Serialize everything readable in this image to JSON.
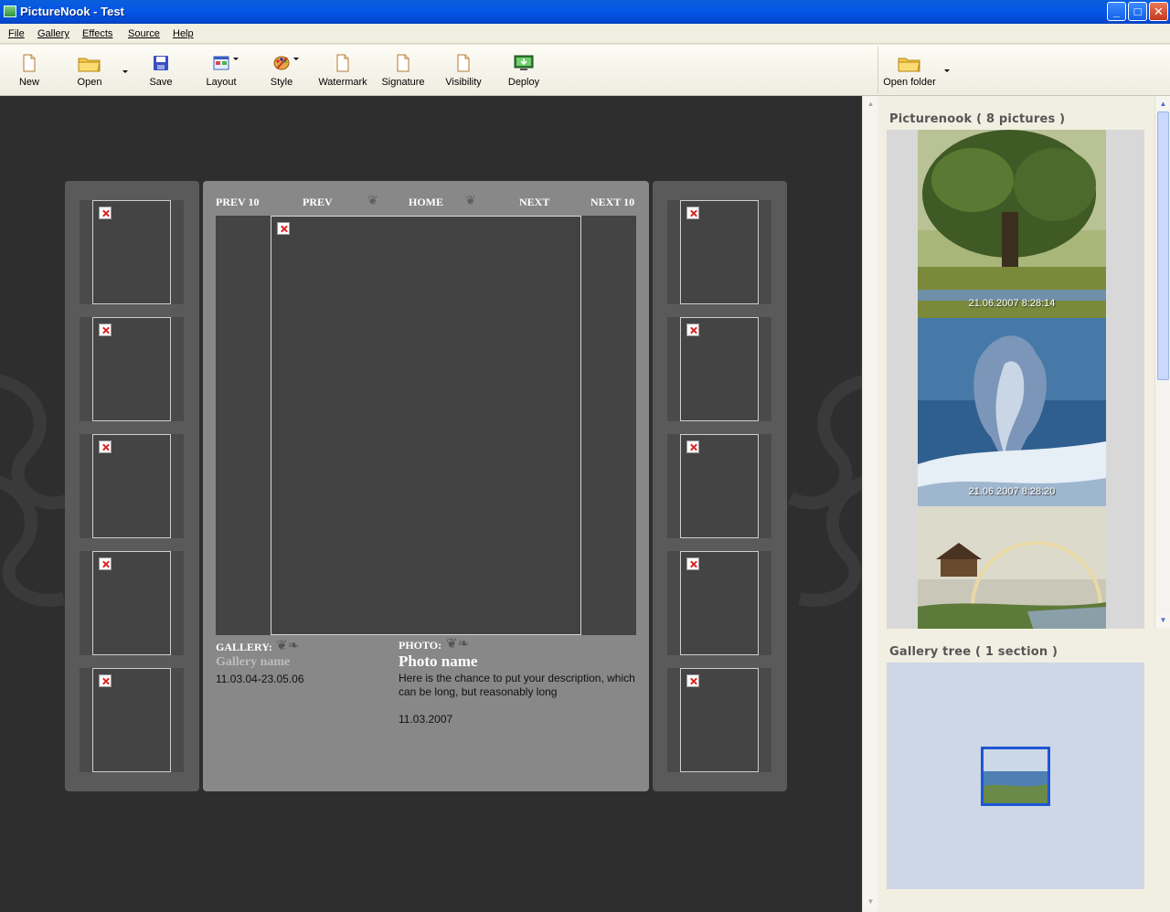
{
  "window": {
    "title": "PictureNook - Test"
  },
  "menu": [
    "File",
    "Gallery",
    "Effects",
    "Source",
    "Help"
  ],
  "toolbar": {
    "new": "New",
    "open": "Open",
    "save": "Save",
    "layout": "Layout",
    "style": "Style",
    "watermark": "Watermark",
    "signature": "Signature",
    "visibility": "Visibility",
    "deploy": "Deploy",
    "open_folder": "Open folder"
  },
  "gallery": {
    "nav": {
      "prev10": "PREV 10",
      "prev": "PREV",
      "home": "HOME",
      "next": "NEXT",
      "next10": "NEXT 10"
    },
    "gallery_label": "GALLERY:",
    "gallery_name": "Gallery name",
    "gallery_dates": "11.03.04-23.05.06",
    "photo_label": "PHOTO:",
    "photo_name": "Photo name",
    "photo_desc": "Here is the chance to put your description, which can be long, but reasonably long",
    "photo_date": "11.03.2007"
  },
  "right_panel": {
    "pictures_header": "Picturenook ( 8 pictures )",
    "pictures": [
      {
        "timestamp": "21.06.2007 8:28:14"
      },
      {
        "timestamp": "21.06.2007 8:28:20"
      },
      {
        "timestamp": ""
      }
    ],
    "tree_header": "Gallery tree ( 1 section )"
  },
  "colors": {
    "titlebar": "#0456e6",
    "preview_bg": "#2e2e2e",
    "center_panel": "#888888",
    "tree_bg": "#cdd7e6",
    "selection": "#1d56d6"
  }
}
